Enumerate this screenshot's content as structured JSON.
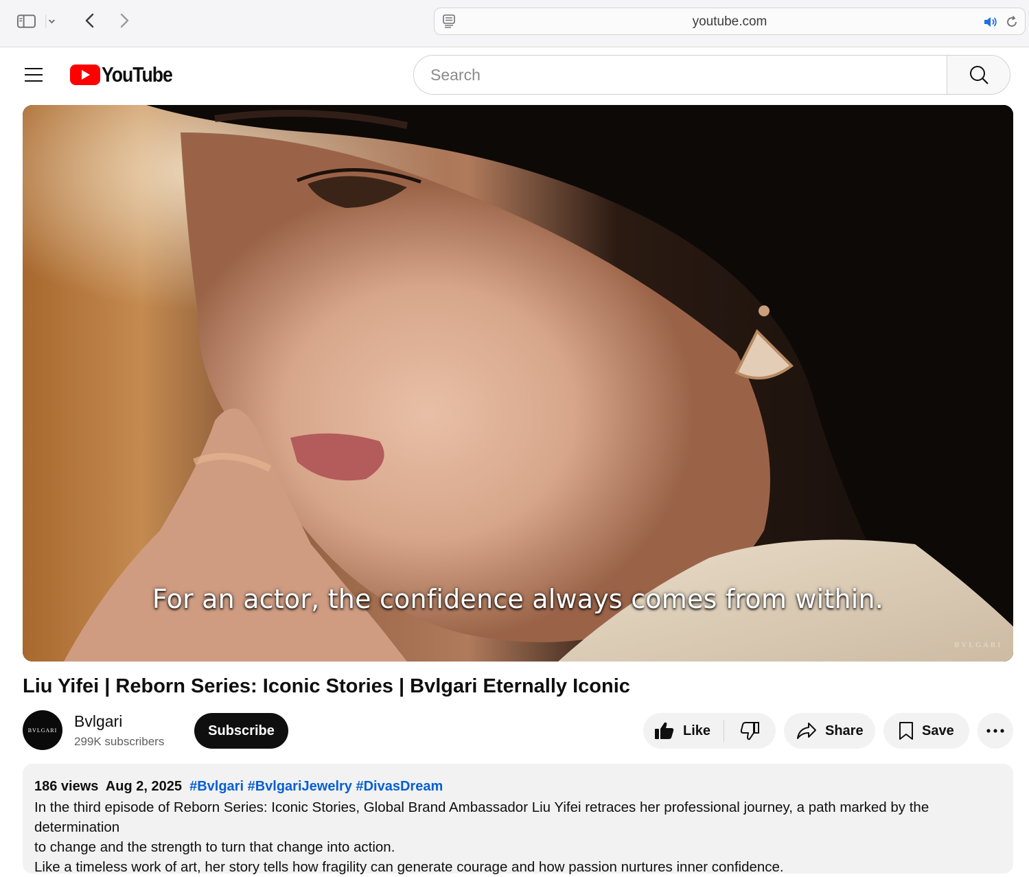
{
  "browser": {
    "url": "youtube.com"
  },
  "header": {
    "logo_text": "YouTube",
    "search_placeholder": "Search"
  },
  "video": {
    "caption": "For an actor, the confidence always comes from within.",
    "watermark": "BVLGARI",
    "title": "Liu Yifei | Reborn Series: Iconic Stories | Bvlgari Eternally Iconic"
  },
  "channel": {
    "avatar_text": "BVLGARI",
    "name": "Bvlgari",
    "subscribers": "299K subscribers",
    "subscribe_label": "Subscribe"
  },
  "actions": {
    "like_label": "Like",
    "share_label": "Share",
    "save_label": "Save"
  },
  "description": {
    "views": "186 views",
    "date": "Aug 2, 2025",
    "hashtags": [
      "#Bvlgari",
      "#BvlgariJewelry",
      "#DivasDream"
    ],
    "lines": [
      "In the third episode of Reborn Series: Iconic Stories, Global Brand Ambassador Liu Yifei retraces her professional journey, a path marked by the determination",
      "to change and the strength to turn that change into action.",
      "Like a timeless work of art, her story tells how fragility can generate courage and how passion nurtures inner confidence."
    ]
  },
  "colors": {
    "youtube_red": "#ff0000",
    "hashtag_blue": "#065fd4",
    "subscribe_bg": "#0f0f0f",
    "pill_bg": "#f2f2f2"
  }
}
